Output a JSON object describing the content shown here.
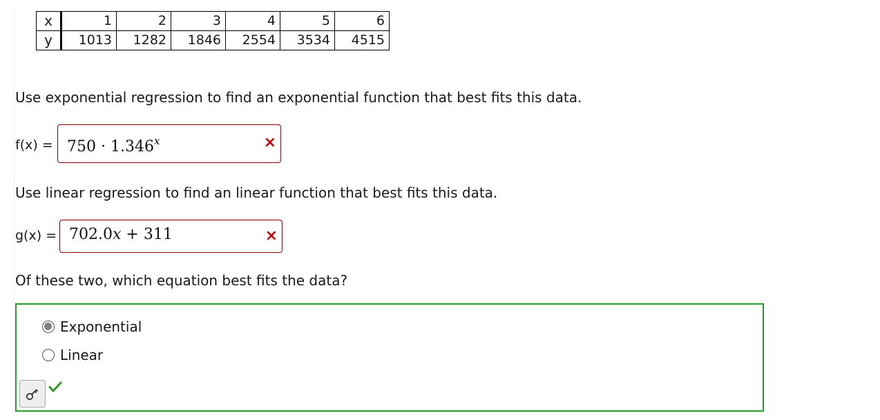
{
  "table": {
    "x_header": "x",
    "y_header": "y",
    "x_values": [
      "1",
      "2",
      "3",
      "4",
      "5",
      "6"
    ],
    "y_values": [
      "1013",
      "1282",
      "1846",
      "2554",
      "3534",
      "4515"
    ]
  },
  "question1": {
    "prompt": "Use exponential regression to find an exponential function that best fits this data.",
    "label": "f(x) =",
    "answer_base": "750 · 1.346",
    "answer_exponent": "x",
    "status_mark": "×",
    "status": "incorrect",
    "status_color": "#c00000"
  },
  "question2": {
    "prompt": "Use linear regression to find an linear function that best fits this data.",
    "label": "g(x) =",
    "answer_coef": "702.0",
    "answer_var": "x",
    "answer_rest": " + 311",
    "status_mark": "×",
    "status": "incorrect",
    "status_color": "#c00000"
  },
  "question3": {
    "prompt": "Of these two, which equation best fits the data?",
    "options": [
      {
        "label": "Exponential",
        "selected": true
      },
      {
        "label": "Linear",
        "selected": false
      }
    ],
    "status": "correct",
    "status_color": "#2a9a2a",
    "key_icon": "key-icon",
    "check_icon": "checkmark-icon"
  },
  "colors": {
    "incorrect_border": "#8b0000",
    "correct_border": "#2a9a2a"
  }
}
